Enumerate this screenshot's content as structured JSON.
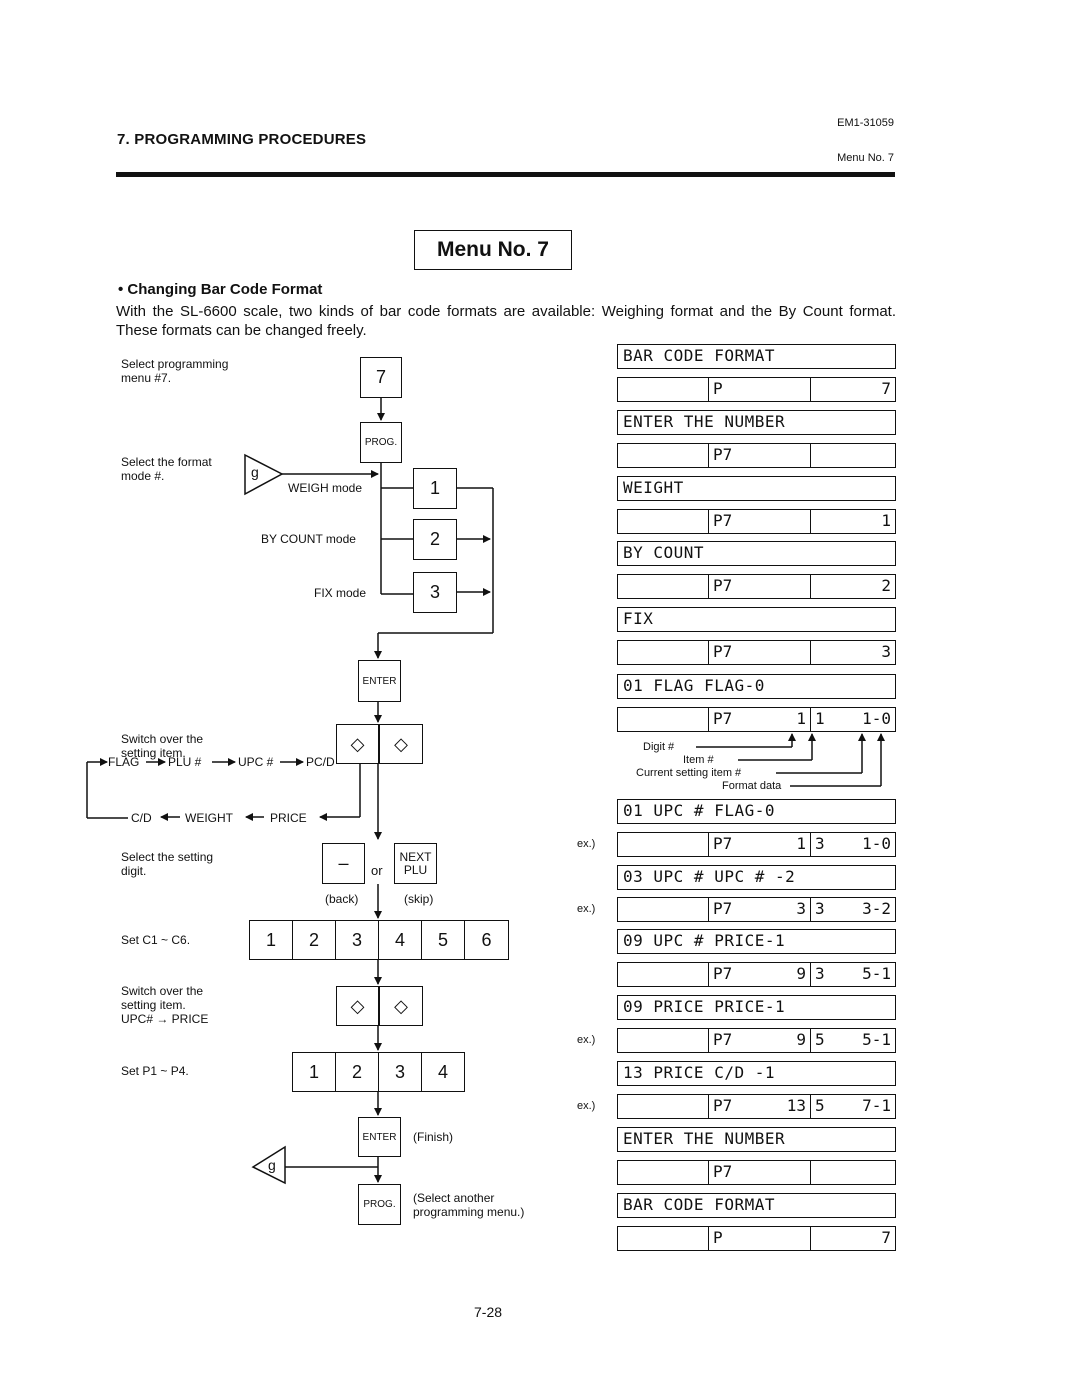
{
  "header": {
    "section_title": "7. PROGRAMMING PROCEDURES",
    "doc_number": "EM1-31059",
    "menu_ref": "Menu No. 7"
  },
  "menu_box": "Menu No. 7",
  "section": {
    "title": "• Changing Bar Code Format",
    "intro": "With the SL-6600 scale, two kinds of bar code formats are available: Weighing format and the By Count format.  These formats can be changed freely."
  },
  "flow": {
    "labels": {
      "select_menu": "Select programming\nmenu #7.",
      "select_format": "Select the format\nmode #.",
      "switch_item": "Switch over the\nsetting item.",
      "select_digit": "Select the setting\ndigit.",
      "set_c": "Set C1 ~ C6.",
      "switch_item2": "Switch over the\nsetting item.\nUPC# → PRICE",
      "set_p": "Set P1 ~ P4.",
      "weigh_mode": "WEIGH mode",
      "bycount_mode": "BY COUNT mode",
      "fix_mode": "FIX mode",
      "or": "or",
      "back": "(back)",
      "skip": "(skip)",
      "finish": "(Finish)",
      "select_another": "(Select another\nprogramming menu.)"
    },
    "keys": {
      "seven": "7",
      "prog": "PROG.",
      "g": "g",
      "mode1": "1",
      "mode2": "2",
      "mode3": "3",
      "enter": "ENTER",
      "diamond": "◇",
      "minus": "–",
      "next_plu": "NEXT\nPLU",
      "c_digits": [
        "1",
        "2",
        "3",
        "4",
        "5",
        "6"
      ],
      "p_digits": [
        "1",
        "2",
        "3",
        "4"
      ]
    },
    "cycle": {
      "top": [
        "FLAG",
        "PLU #",
        "UPC #",
        "PC/D"
      ],
      "bottom": [
        "C/D",
        "WEIGHT",
        "PRICE"
      ]
    }
  },
  "displays": [
    {
      "type": "text",
      "text": "BAR CODE FORMAT"
    },
    {
      "type": "cells",
      "c2l": "P",
      "c2r": "",
      "c3l": "",
      "c3r": "7"
    },
    {
      "type": "text",
      "text": "ENTER THE NUMBER"
    },
    {
      "type": "cells",
      "c2l": "P7",
      "c2r": "",
      "c3l": "",
      "c3r": ""
    },
    {
      "type": "text",
      "text": "WEIGHT"
    },
    {
      "type": "cells",
      "c2l": "P7",
      "c2r": "",
      "c3l": "",
      "c3r": "1"
    },
    {
      "type": "text",
      "text": "BY COUNT"
    },
    {
      "type": "cells",
      "c2l": "P7",
      "c2r": "",
      "c3l": "",
      "c3r": "2"
    },
    {
      "type": "text",
      "text": "FIX"
    },
    {
      "type": "cells",
      "c2l": "P7",
      "c2r": "",
      "c3l": "",
      "c3r": "3"
    },
    {
      "type": "text",
      "text": "01 FLAG FLAG-0"
    },
    {
      "type": "cells",
      "c2l": "P7",
      "c2r": "1",
      "c3l": "1",
      "c3r": "1-0"
    },
    {
      "type": "text",
      "text": "01 UPC # FLAG-0"
    },
    {
      "type": "cells",
      "c2l": "P7",
      "c2r": "1",
      "c3l": "3",
      "c3r": "1-0",
      "ex": "ex.)"
    },
    {
      "type": "text",
      "text": "03 UPC # UPC # -2"
    },
    {
      "type": "cells",
      "c2l": "P7",
      "c2r": "3",
      "c3l": "3",
      "c3r": "3-2",
      "ex": "ex.)"
    },
    {
      "type": "text",
      "text": "09 UPC # PRICE-1"
    },
    {
      "type": "cells",
      "c2l": "P7",
      "c2r": "9",
      "c3l": "3",
      "c3r": "5-1"
    },
    {
      "type": "text",
      "text": "09 PRICE PRICE-1"
    },
    {
      "type": "cells",
      "c2l": "P7",
      "c2r": "9",
      "c3l": "5",
      "c3r": "5-1",
      "ex": "ex.)"
    },
    {
      "type": "text",
      "text": "13 PRICE C/D -1"
    },
    {
      "type": "cells",
      "c2l": "P7",
      "c2r": "13",
      "c3l": "5",
      "c3r": "7-1",
      "ex": "ex.)"
    },
    {
      "type": "text",
      "text": "ENTER THE NUMBER"
    },
    {
      "type": "cells",
      "c2l": "P7",
      "c2r": "",
      "c3l": "",
      "c3r": ""
    },
    {
      "type": "text",
      "text": "BAR CODE FORMAT"
    },
    {
      "type": "cells",
      "c2l": "P",
      "c2r": "",
      "c3l": "",
      "c3r": "7"
    }
  ],
  "annotations": {
    "digit": "Digit #",
    "item": "Item #",
    "current_item": "Current setting item #",
    "format_data": "Format data"
  },
  "footer": {
    "page_number": "7-28"
  }
}
